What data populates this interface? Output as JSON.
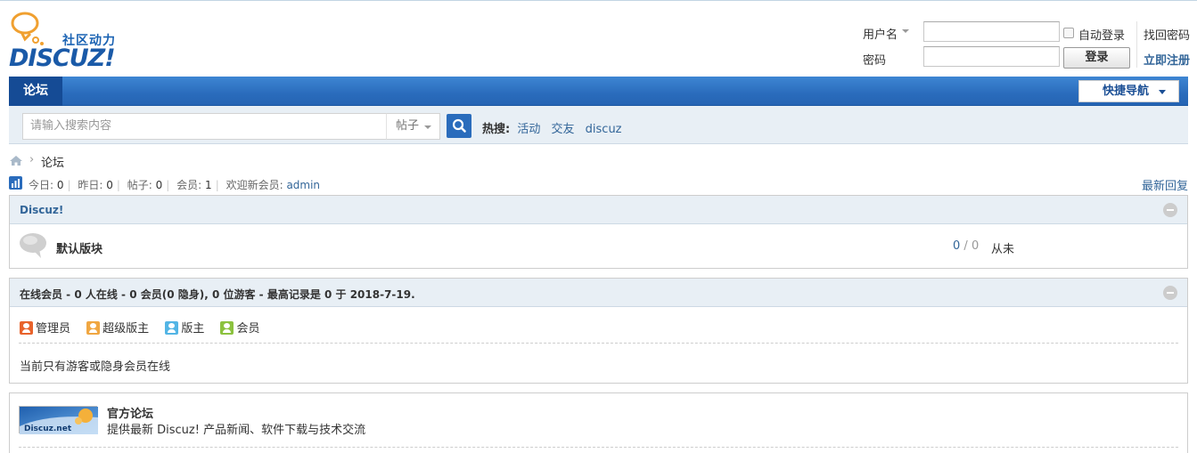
{
  "header": {
    "logo_tagline": "社区动力",
    "logo_word": "DISCUZ!",
    "login": {
      "username_label": "用户名",
      "password_label": "密码",
      "auto_login_label": "自动登录",
      "login_button": "登录",
      "find_password": "找回密码",
      "register": "立即注册"
    }
  },
  "nav": {
    "active_tab": "论坛",
    "quick_nav": "快捷导航"
  },
  "search": {
    "placeholder": "请输入搜索内容",
    "type": "帖子",
    "hot_label": "热搜:",
    "hot_links": [
      "活动",
      "交友",
      "discuz"
    ]
  },
  "breadcrumb": {
    "current": "论坛"
  },
  "stats": {
    "today_label": "今日:",
    "today": "0",
    "yesterday_label": "昨日:",
    "yesterday": "0",
    "posts_label": "帖子:",
    "posts": "0",
    "members_label": "会员:",
    "members": "1",
    "welcome_label": "欢迎新会员:",
    "newest_member": "admin",
    "latest_replies": "最新回复"
  },
  "category": {
    "title": "Discuz!",
    "forums": [
      {
        "name": "默认版块",
        "threads": "0",
        "sep": " / ",
        "posts": "0",
        "last_post": "从未"
      }
    ]
  },
  "online": {
    "title": "在线会员 - 0 人在线 - 0 会员(0 隐身), 0 位游客 - 最高记录是 0 于 2018-7-19.",
    "legend": [
      {
        "label": "管理员",
        "color": "#e8632c"
      },
      {
        "label": "超级版主",
        "color": "#f0a742"
      },
      {
        "label": "版主",
        "color": "#53b5e5"
      },
      {
        "label": "会员",
        "color": "#8cc23f"
      }
    ],
    "status": "当前只有游客或隐身会员在线"
  },
  "links": {
    "logo_text": "Discuz.net",
    "title": "官方论坛",
    "desc": "提供最新 Discuz! 产品新闻、软件下载与技术交流"
  }
}
